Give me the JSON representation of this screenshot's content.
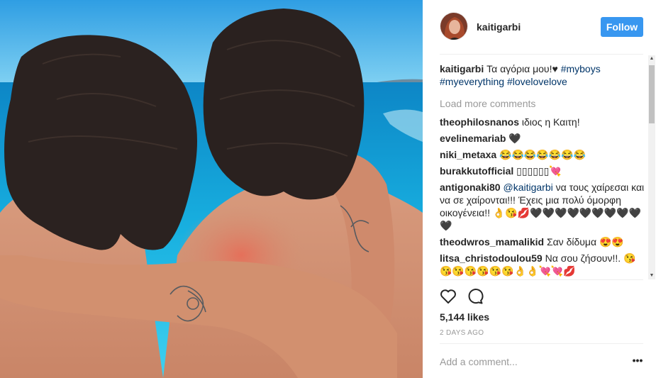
{
  "post": {
    "author": "kaitigarbi",
    "follow_label": "Follow",
    "caption": {
      "user": "kaitigarbi",
      "text": " Τα αγόρια μου!♥ ",
      "tags": [
        "#myboys",
        "#myeverything",
        "#lovelovelove"
      ]
    },
    "load_more_label": "Load more comments",
    "comments": [
      {
        "user": "theophilosnanos",
        "text": "ιδιος η Καιτη!"
      },
      {
        "user": "evelinemariab",
        "text": "🖤"
      },
      {
        "user": "niki_metaxa",
        "text": "😂😂😂😂😂😂😂"
      },
      {
        "user": "burakkutofficial",
        "text": "▯▯▯▯▯▯💘"
      },
      {
        "user": "antigonaki80",
        "mention": "@kaitigarbi",
        "text": "να τους χαίρεσαι και να σε χαίρονται!!! Έχεις μια πολύ όμορφη οικογένεια!! 👌😘💋🖤🖤🖤🖤🖤🖤🖤🖤🖤🖤"
      },
      {
        "user": "theodwros_mamalikid",
        "text": "Σαν δίδυμα 😍😍"
      },
      {
        "user": "litsa_christodoulou59",
        "text": "Να σου ζήσουν!!. 😘😘😘😘😘😘😘👌👌💘💘💋"
      }
    ],
    "likes": "5,144 likes",
    "time_ago": "2 DAYS AGO",
    "add_comment_placeholder": "Add a comment...",
    "more_label": "•••"
  },
  "icons": {
    "like": "heart-outline-icon",
    "comment": "speech-bubble-icon",
    "more": "ellipsis-icon"
  },
  "colors": {
    "follow_blue": "#3897f0",
    "hashtag_blue": "#003569",
    "muted_gray": "#999999",
    "sea": "#19a3d8",
    "sky": "#5fc6ef"
  }
}
